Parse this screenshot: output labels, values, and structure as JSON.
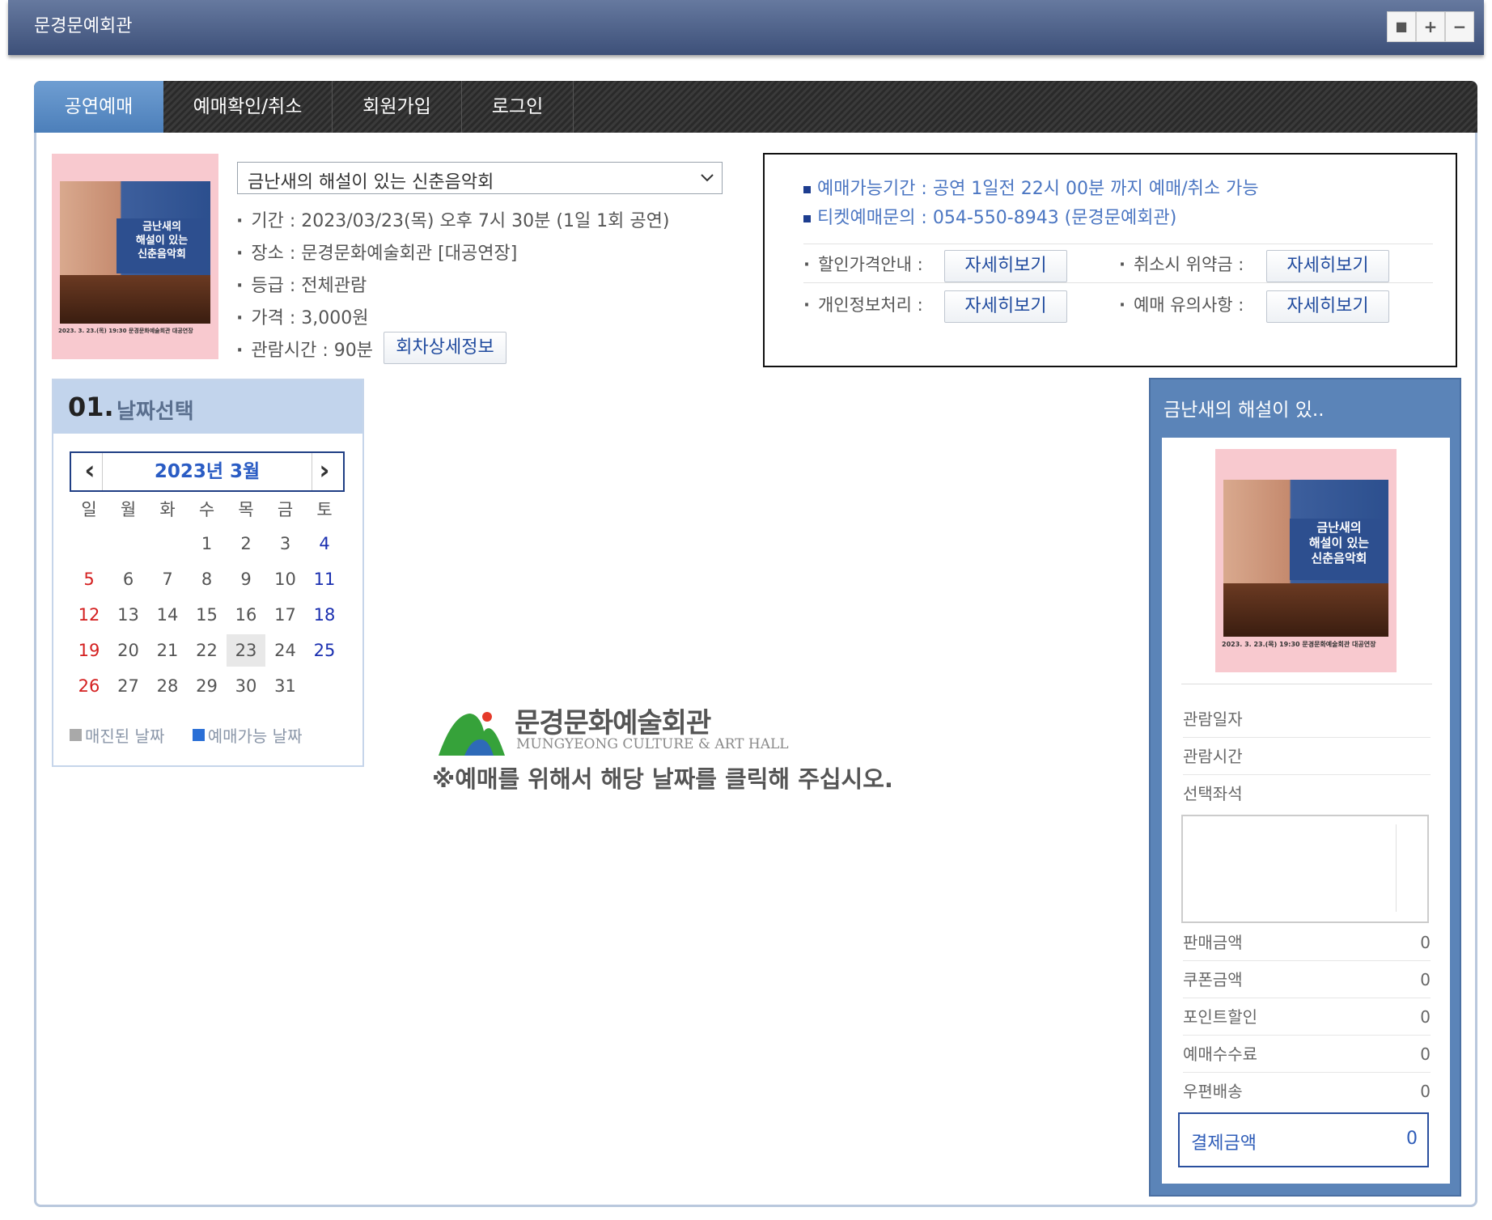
{
  "window": {
    "title": "문경문예회관",
    "controls": [
      "■",
      "+",
      "−"
    ]
  },
  "tabs": [
    {
      "label": "공연예매",
      "active": true
    },
    {
      "label": "예매확인/취소",
      "active": false
    },
    {
      "label": "회원가입",
      "active": false
    },
    {
      "label": "로그인",
      "active": false
    }
  ],
  "show": {
    "select_value": "금난새의 해설이 있는 신춘음악회",
    "details": [
      "기간 : 2023/03/23(목) 오후 7시 30분 (1일 1회 공연)",
      "장소 : 문경문화예술회관 [대공연장]",
      "등급 : 전체관람",
      "가격 : 3,000원",
      "관람시간 : 90분"
    ],
    "detail_button": "회차상세정보"
  },
  "poster": {
    "title_lines": [
      "금난새의",
      "해설이 있는",
      "신춘음악회"
    ],
    "date_text": "2023. 3. 23.(목) 19:30 문경문화예술회관 대공연장"
  },
  "info": {
    "lines": [
      "예매가능기간 : 공연 1일전 22시 00분 까지 예매/취소 가능",
      "티켓예매문의 : 054-550-8943 (문경문예회관)"
    ],
    "links": [
      {
        "label": "할인가격안내 :",
        "button": "자세히보기"
      },
      {
        "label": "취소시 위약금 :",
        "button": "자세히보기"
      },
      {
        "label": "개인정보처리 :",
        "button": "자세히보기"
      },
      {
        "label": "예매 유의사항 :",
        "button": "자세히보기"
      }
    ]
  },
  "calendar": {
    "step_number": "01.",
    "step_title": "날짜선택",
    "month_label": "2023년 3월",
    "prev": "‹",
    "next": "›",
    "weekdays": [
      "일",
      "월",
      "화",
      "수",
      "목",
      "금",
      "토"
    ],
    "weeks": [
      [
        "",
        "",
        "",
        "1",
        "2",
        "3",
        "4"
      ],
      [
        "5",
        "6",
        "7",
        "8",
        "9",
        "10",
        "11"
      ],
      [
        "12",
        "13",
        "14",
        "15",
        "16",
        "17",
        "18"
      ],
      [
        "19",
        "20",
        "21",
        "22",
        "23",
        "24",
        "25"
      ],
      [
        "26",
        "27",
        "28",
        "29",
        "30",
        "31",
        ""
      ]
    ],
    "highlight_day": "23",
    "legend": [
      {
        "label": "매진된 날짜",
        "color": "#a9a9a9"
      },
      {
        "label": "예매가능 날짜",
        "color": "#2a6fd6"
      }
    ]
  },
  "center": {
    "logo_title": "문경문화예술회관",
    "logo_sub": "MUNGYEONG CULTURE & ART HALL",
    "notice": "※예매를 위해서 해당 날짜를 클릭해 주십시오."
  },
  "summary": {
    "title": "금난새의 해설이 있..",
    "fields": [
      {
        "label": "관람일자"
      },
      {
        "label": "관람시간"
      },
      {
        "label": "선택좌석"
      }
    ],
    "amounts": [
      {
        "label": "판매금액",
        "value": "0"
      },
      {
        "label": "쿠폰금액",
        "value": "0"
      },
      {
        "label": "포인트할인",
        "value": "0"
      },
      {
        "label": "예매수수료",
        "value": "0"
      },
      {
        "label": "우편배송",
        "value": "0"
      }
    ],
    "total": {
      "label": "결제금액",
      "value": "0"
    }
  },
  "colors": {
    "titlebar": "#4a5e86",
    "tab_active": "#5b8fc7",
    "link_blue": "#2e5cb8",
    "sunday_red": "#d41f1f",
    "saturday_blue": "#1a2fb0"
  }
}
